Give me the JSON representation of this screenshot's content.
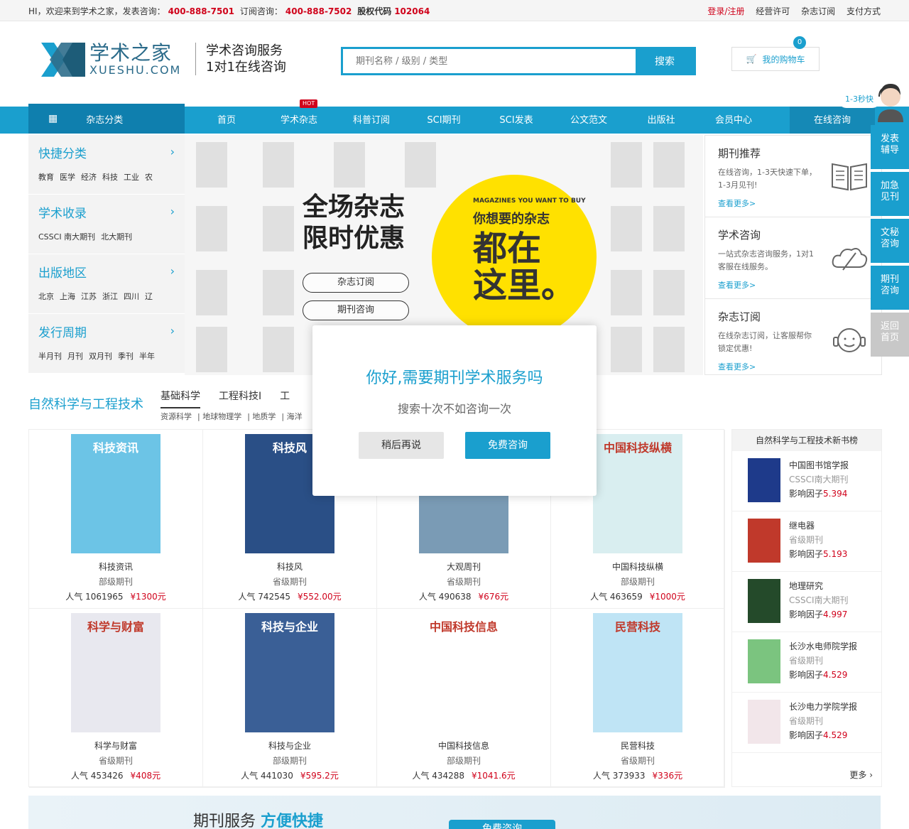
{
  "topbar": {
    "greeting": "HI，欢迎来到学术之家，发表咨询：",
    "publish_phone": "400-888-7501",
    "subscribe_label": "订阅咨询：",
    "subscribe_phone": "400-888-7502",
    "stock_label": "股权代码",
    "stock_code": "102064",
    "login": "登录/注册",
    "license": "经营许可",
    "subscribe": "杂志订阅",
    "payment": "支付方式"
  },
  "header": {
    "logo_cn": "学术之家",
    "logo_en": "XUESHU.COM",
    "slogan_line1": "学术咨询服务",
    "slogan_line2": "1对1在线咨询",
    "search_placeholder": "期刊名称 / 级别 / 类型",
    "search_button": "搜索",
    "cart_label": "我的购物车",
    "cart_count": "0"
  },
  "nav": {
    "category": "杂志分类",
    "items": [
      "首页",
      "学术杂志",
      "科普订阅",
      "SCI期刊",
      "SCI发表",
      "公文范文",
      "出版社",
      "会员中心"
    ],
    "hot_badge": "HOT",
    "online": "在线咨询"
  },
  "sidebar": [
    {
      "title": "快捷分类",
      "links": [
        "教育",
        "医学",
        "经济",
        "科技",
        "工业",
        "农"
      ]
    },
    {
      "title": "学术收录",
      "links": [
        "CSSCI 南大期刊",
        "北大期刊"
      ]
    },
    {
      "title": "出版地区",
      "links": [
        "北京",
        "上海",
        "江苏",
        "浙江",
        "四川",
        "辽"
      ]
    },
    {
      "title": "发行周期",
      "links": [
        "半月刊",
        "月刊",
        "双月刊",
        "季刊",
        "半年"
      ]
    }
  ],
  "banner": {
    "title_line1": "全场杂志",
    "title_line2": "限时优惠",
    "btn1": "杂志订阅",
    "btn2": "期刊咨询",
    "circle_small": "MAGAZINES YOU WANT TO BUY",
    "circle_mid": "你想要的杂志",
    "circle_big1": "都在",
    "circle_big2": "这里。"
  },
  "right_panel": [
    {
      "title": "期刊推荐",
      "desc": "在线咨询，1-3天快速下单，1-3月见刊!",
      "more": "查看更多>",
      "icon": "book-icon"
    },
    {
      "title": "学术咨询",
      "desc": "一站式杂志咨询服务，1对1客服在线服务。",
      "more": "查看更多>",
      "icon": "cloud-chat-icon"
    },
    {
      "title": "杂志订阅",
      "desc": "在线杂志订阅，让客服帮你锁定优惠!",
      "more": "查看更多>",
      "icon": "headset-icon"
    }
  ],
  "section": {
    "title": "自然科学与工程技术",
    "tabs": [
      "基础科学",
      "工程科技I",
      "工"
    ],
    "subtabs": [
      "资源科学",
      "地球物理学",
      "地质学",
      "海洋"
    ]
  },
  "journals": [
    {
      "name": "科技资讯",
      "level": "部级期刊",
      "pop_label": "人气",
      "pop": "1061965",
      "price": "¥1300元",
      "cover_title": "科技资讯",
      "color": "#6cc4e6"
    },
    {
      "name": "科技风",
      "level": "省级期刊",
      "pop_label": "人气",
      "pop": "742545",
      "price": "¥552.00元",
      "cover_title": "科技风",
      "color": "#2a4f86"
    },
    {
      "name": "大观周刊",
      "level": "省级期刊",
      "pop_label": "人气",
      "pop": "490638",
      "price": "¥676元",
      "cover_title": "",
      "color": "#7a9bb5"
    },
    {
      "name": "中国科技纵横",
      "level": "部级期刊",
      "pop_label": "人气",
      "pop": "463659",
      "price": "¥1000元",
      "cover_title": "中国科技纵横",
      "color": "#d9eef0"
    },
    {
      "name": "科学与财富",
      "level": "省级期刊",
      "pop_label": "人气",
      "pop": "453426",
      "price": "¥408元",
      "cover_title": "科学与财富",
      "color": "#e8e8ef"
    },
    {
      "name": "科技与企业",
      "level": "部级期刊",
      "pop_label": "人气",
      "pop": "441030",
      "price": "¥595.2元",
      "cover_title": "科技与企业",
      "color": "#3a5f96"
    },
    {
      "name": "中国科技信息",
      "level": "部级期刊",
      "pop_label": "人气",
      "pop": "434288",
      "price": "¥1041.6元",
      "cover_title": "中国科技信息",
      "color": "#ffffff"
    },
    {
      "name": "民营科技",
      "level": "省级期刊",
      "pop_label": "人气",
      "pop": "373933",
      "price": "¥336元",
      "cover_title": "民营科技",
      "color": "#bfe4f5"
    }
  ],
  "ranking": {
    "head": "自然科学与工程技术新书榜",
    "impact_label": "影响因子",
    "more": "更多",
    "items": [
      {
        "name": "中国图书馆学报",
        "level": "CSSCI南大期刊",
        "impact": "5.394",
        "color": "#1e3a8a"
      },
      {
        "name": "继电器",
        "level": "省级期刊",
        "impact": "5.193",
        "color": "#c0392b"
      },
      {
        "name": "地理研究",
        "level": "CSSCI南大期刊",
        "impact": "4.997",
        "color": "#244a2a"
      },
      {
        "name": "长沙水电师院学报",
        "level": "省级期刊",
        "impact": "4.529",
        "color": "#7bc47f"
      },
      {
        "name": "长沙电力学院学报",
        "level": "省级期刊",
        "impact": "4.529",
        "color": "#f2e6ea"
      }
    ]
  },
  "bottom_banner": {
    "title_a": "期刊服务",
    "title_b": "方便快捷",
    "button": "免费咨询"
  },
  "float_rail": {
    "tip": "1-3秒快",
    "items": [
      {
        "l1": "发表",
        "l2": "辅导"
      },
      {
        "l1": "加急",
        "l2": "见刊"
      },
      {
        "l1": "文秘",
        "l2": "咨询"
      },
      {
        "l1": "期刊",
        "l2": "咨询"
      },
      {
        "l1": "返回",
        "l2": "首页"
      }
    ]
  },
  "modal": {
    "title": "你好,需要期刊学术服务吗",
    "subtitle": "搜索十次不如咨询一次",
    "later": "稍后再说",
    "free": "免费咨询"
  }
}
